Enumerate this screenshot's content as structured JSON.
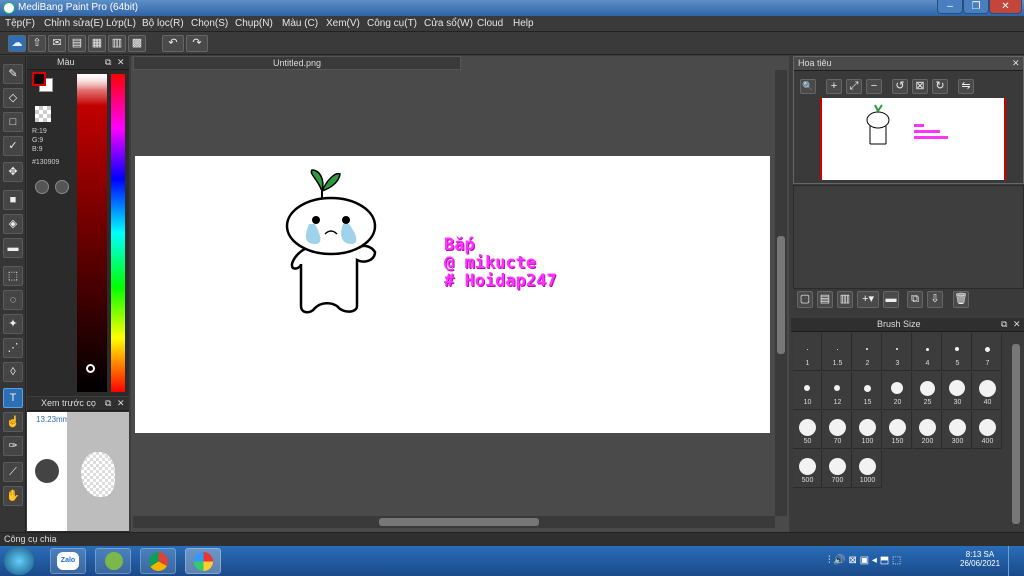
{
  "window": {
    "title": "MediBang Paint Pro (64bit)",
    "min": "–",
    "max": "❐",
    "close": "✕"
  },
  "menu": [
    "Tệp(F)",
    "Chỉnh sửa(E)",
    "Lớp(L)",
    "Bộ lọc(R)",
    "Chọn(S)",
    "Chụp(N)",
    "Màu (C)",
    "Xem(V)",
    "Công cụ(T)",
    "Cửa sổ(W)",
    "Cloud",
    "Help"
  ],
  "color_panel": {
    "title": "Màu",
    "r": "R:19",
    "g": "G:9",
    "b": "B:9",
    "hex": "#130909"
  },
  "preview_panel": {
    "title": "Xem trước cọ",
    "size": "13.23mm"
  },
  "canvas": {
    "tab": "Untitled.png"
  },
  "artwork": {
    "line1": "Bắp",
    "line2": "@ mikucte",
    "line3": "# Hoidap247"
  },
  "navigator": {
    "title": "Hoa tiêu"
  },
  "brush_panel": {
    "title": "Brush Size",
    "sizes": [
      "1",
      "1.5",
      "2",
      "3",
      "4",
      "5",
      "7",
      "10",
      "12",
      "15",
      "20",
      "25",
      "30",
      "40",
      "50",
      "70",
      "100",
      "150",
      "200",
      "300",
      "400",
      "500",
      "700",
      "1000"
    ]
  },
  "status": {
    "text": "Công cụ chia"
  },
  "taskbar": {
    "time": "8:13 SA",
    "date": "26/06/2021",
    "zalo": "Zalo"
  },
  "colors": {
    "accent": "#2d6fb5",
    "artwork_text": "#ff33ff",
    "current_color": "#130909"
  }
}
